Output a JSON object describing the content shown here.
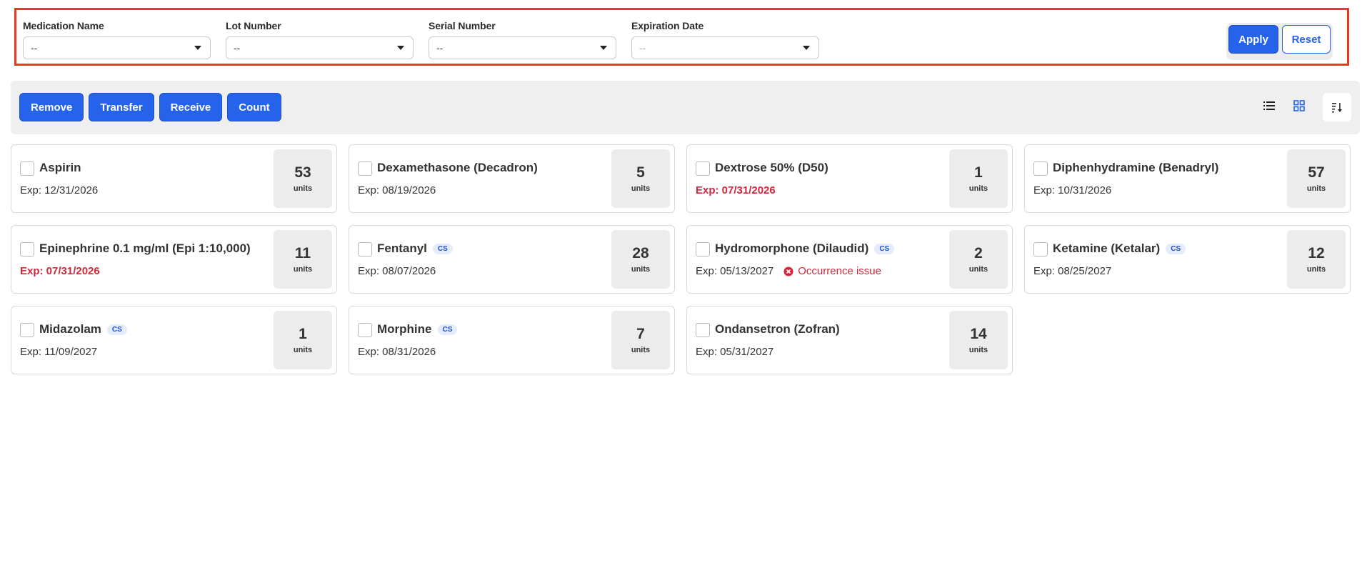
{
  "filters": {
    "medication_name": {
      "label": "Medication Name",
      "value": "--"
    },
    "lot_number": {
      "label": "Lot Number",
      "value": "--"
    },
    "serial_number": {
      "label": "Serial Number",
      "value": "--"
    },
    "expiration_date": {
      "label": "Expiration Date",
      "value": "--"
    },
    "apply_label": "Apply",
    "reset_label": "Reset"
  },
  "toolbar": {
    "remove_label": "Remove",
    "transfer_label": "Transfer",
    "receive_label": "Receive",
    "count_label": "Count",
    "active_view": "grid"
  },
  "colors": {
    "accent": "#2563eb",
    "expired": "#d3263b",
    "highlight_border": "#e8381f"
  },
  "medications": [
    {
      "name": "Aspirin",
      "cs": false,
      "exp": "Exp: 12/31/2026",
      "expired": false,
      "issue": "",
      "qty": "53",
      "unit": "units"
    },
    {
      "name": "Dexamethasone (Decadron)",
      "cs": false,
      "exp": "Exp: 08/19/2026",
      "expired": false,
      "issue": "",
      "qty": "5",
      "unit": "units"
    },
    {
      "name": "Dextrose 50% (D50)",
      "cs": false,
      "exp": "Exp: 07/31/2026",
      "expired": true,
      "issue": "",
      "qty": "1",
      "unit": "units"
    },
    {
      "name": "Diphenhydramine (Benadryl)",
      "cs": false,
      "exp": "Exp: 10/31/2026",
      "expired": false,
      "issue": "",
      "qty": "57",
      "unit": "units"
    },
    {
      "name": "Epinephrine 0.1 mg/ml (Epi 1:10,000)",
      "cs": false,
      "exp": "Exp: 07/31/2026",
      "expired": true,
      "issue": "",
      "qty": "11",
      "unit": "units"
    },
    {
      "name": "Fentanyl",
      "cs": true,
      "cs_label": "CS",
      "exp": "Exp: 08/07/2026",
      "expired": false,
      "issue": "",
      "qty": "28",
      "unit": "units"
    },
    {
      "name": "Hydromorphone (Dilaudid)",
      "cs": true,
      "cs_label": "CS",
      "exp": "Exp: 05/13/2027",
      "expired": false,
      "issue": "Occurrence issue",
      "qty": "2",
      "unit": "units"
    },
    {
      "name": "Ketamine (Ketalar)",
      "cs": true,
      "cs_label": "CS",
      "exp": "Exp: 08/25/2027",
      "expired": false,
      "issue": "",
      "qty": "12",
      "unit": "units"
    },
    {
      "name": "Midazolam",
      "cs": true,
      "cs_label": "CS",
      "exp": "Exp: 11/09/2027",
      "expired": false,
      "issue": "",
      "qty": "1",
      "unit": "units"
    },
    {
      "name": "Morphine",
      "cs": true,
      "cs_label": "CS",
      "exp": "Exp: 08/31/2026",
      "expired": false,
      "issue": "",
      "qty": "7",
      "unit": "units"
    },
    {
      "name": "Ondansetron (Zofran)",
      "cs": false,
      "exp": "Exp: 05/31/2027",
      "expired": false,
      "issue": "",
      "qty": "14",
      "unit": "units"
    }
  ]
}
